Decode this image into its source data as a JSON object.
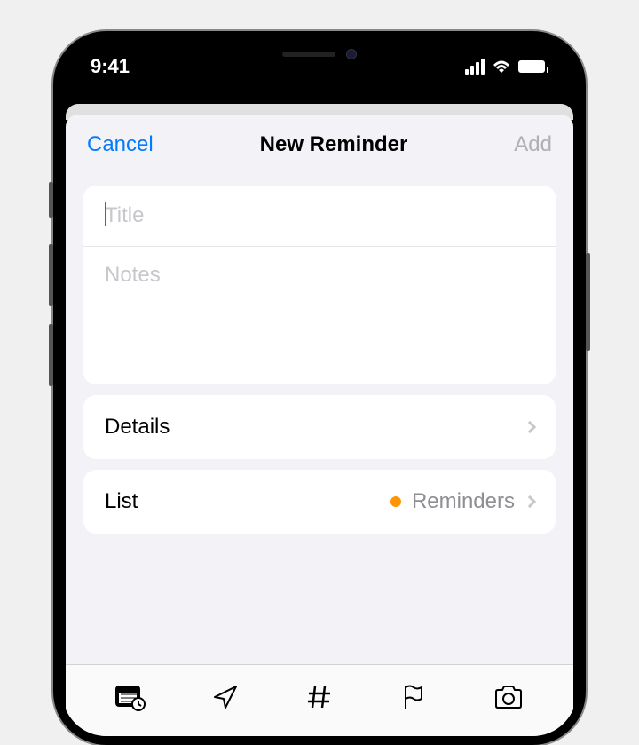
{
  "status": {
    "time": "9:41"
  },
  "modal": {
    "cancel": "Cancel",
    "title": "New Reminder",
    "add": "Add"
  },
  "form": {
    "title_placeholder": "Title",
    "notes_placeholder": "Notes",
    "details_label": "Details",
    "list_label": "List",
    "list_value": "Reminders",
    "list_color": "#ff9500"
  }
}
